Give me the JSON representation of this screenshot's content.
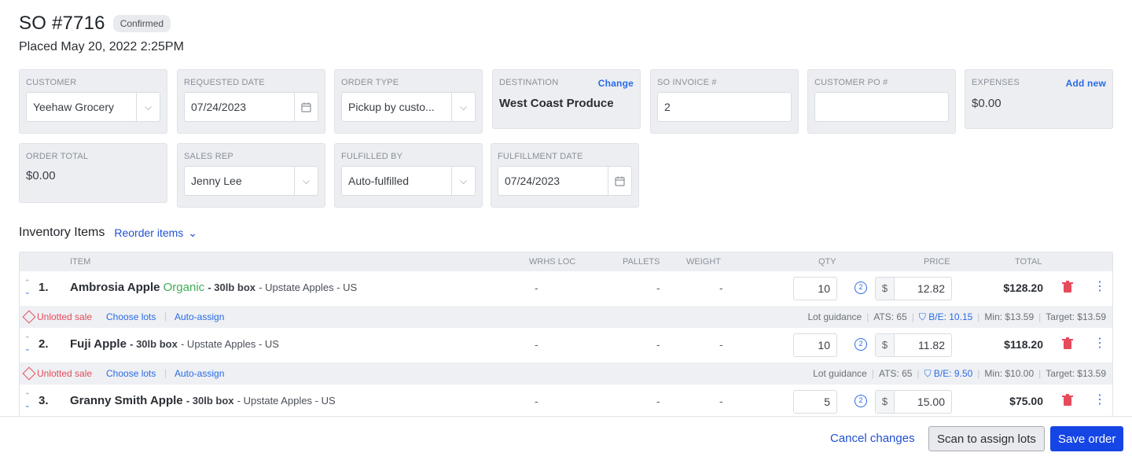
{
  "order": {
    "title": "SO #7716",
    "status": "Confirmed",
    "placed": "Placed May 20, 2022 2:25PM"
  },
  "fields": {
    "customer": {
      "label": "CUSTOMER",
      "value": "Yeehaw Grocery"
    },
    "requested_date": {
      "label": "REQUESTED DATE",
      "value": "07/24/2023"
    },
    "order_type": {
      "label": "ORDER TYPE",
      "value": "Pickup by custo..."
    },
    "destination": {
      "label": "DESTINATION",
      "link": "Change",
      "value": "West Coast Produce"
    },
    "so_invoice": {
      "label": "SO INVOICE #",
      "value": "2"
    },
    "customer_po": {
      "label": "CUSTOMER PO #",
      "value": ""
    },
    "expenses": {
      "label": "EXPENSES",
      "link": "Add new",
      "value": "$0.00"
    },
    "order_total": {
      "label": "ORDER TOTAL",
      "value": "$0.00"
    },
    "sales_rep": {
      "label": "SALES REP",
      "value": "Jenny Lee"
    },
    "fulfilled_by": {
      "label": "FULFILLED BY",
      "value": "Auto-fulfilled"
    },
    "fulfillment_date": {
      "label": "FULFILLMENT DATE",
      "value": "07/24/2023"
    }
  },
  "inventory": {
    "title": "Inventory Items",
    "reorder_label": "Reorder items",
    "columns": {
      "item": "ITEM",
      "wrhs_loc": "WRHS LOC",
      "pallets": "PALLETS",
      "weight": "WEIGHT",
      "qty": "QTY",
      "price": "PRICE",
      "total": "TOTAL"
    },
    "rows": [
      {
        "num": "1.",
        "name": "Ambrosia Apple",
        "tag": "Organic",
        "size": "- 30lb box",
        "meta": "- Upstate Apples - US",
        "wrhs": "-",
        "pallets": "-",
        "weight": "-",
        "qty": "10",
        "currency": "$",
        "price": "12.82",
        "total": "$128.20",
        "warning": "Unlotted sale",
        "choose": "Choose lots",
        "auto": "Auto-assign",
        "guidance": "Lot guidance",
        "ats": "ATS: 65",
        "be": "B/E: 10.15",
        "min": "Min: $13.59",
        "target": "Target: $13.59"
      },
      {
        "num": "2.",
        "name": "Fuji Apple",
        "tag": "",
        "size": "- 30lb box",
        "meta": "- Upstate Apples - US",
        "wrhs": "-",
        "pallets": "-",
        "weight": "-",
        "qty": "10",
        "currency": "$",
        "price": "11.82",
        "total": "$118.20",
        "warning": "Unlotted sale",
        "choose": "Choose lots",
        "auto": "Auto-assign",
        "guidance": "Lot guidance",
        "ats": "ATS: 65",
        "be": "B/E: 9.50",
        "min": "Min: $10.00",
        "target": "Target: $13.59"
      },
      {
        "num": "3.",
        "name": "Granny Smith Apple",
        "tag": "",
        "size": "- 30lb box",
        "meta": "- Upstate Apples - US",
        "wrhs": "-",
        "pallets": "-",
        "weight": "-",
        "qty": "5",
        "currency": "$",
        "price": "15.00",
        "total": "$75.00"
      }
    ]
  },
  "footer": {
    "cancel": "Cancel changes",
    "scan": "Scan to assign lots",
    "save": "Save order"
  }
}
